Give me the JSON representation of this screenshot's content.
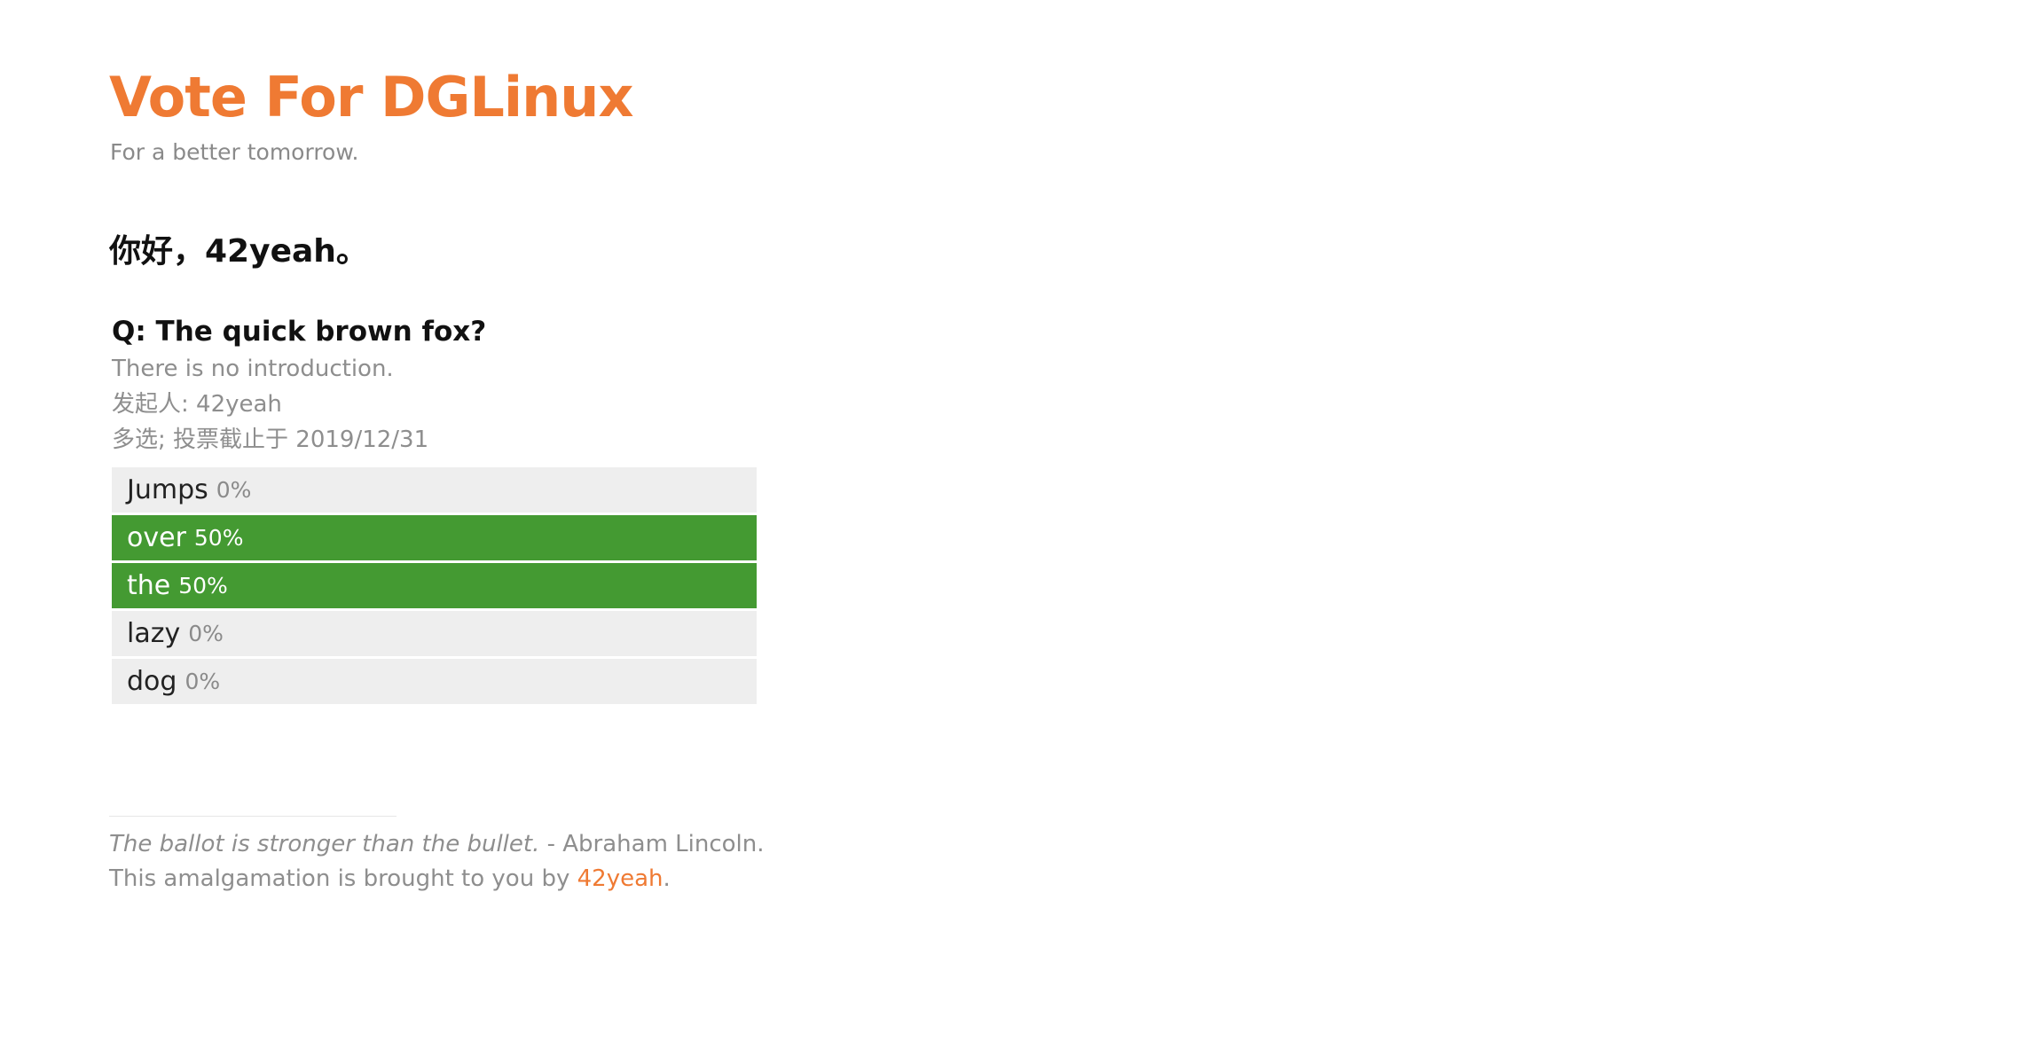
{
  "header": {
    "title": "Vote For DGLinux",
    "subtitle": "For a better tomorrow."
  },
  "greeting": "你好，42yeah。",
  "poll": {
    "question": "Q: The quick brown fox?",
    "introduction": "There is no introduction.",
    "initiator": "发起人: 42yeah",
    "mode_deadline": "多选; 投票截止于 2019/12/31",
    "options": [
      {
        "label": "Jumps",
        "percent": "0%",
        "fraction": 0,
        "selected": false
      },
      {
        "label": "over",
        "percent": "50%",
        "fraction": 1,
        "selected": true
      },
      {
        "label": "the",
        "percent": "50%",
        "fraction": 1,
        "selected": true
      },
      {
        "label": "lazy",
        "percent": "0%",
        "fraction": 0,
        "selected": false
      },
      {
        "label": "dog",
        "percent": "0%",
        "fraction": 0,
        "selected": false
      }
    ]
  },
  "footer": {
    "quote": "The ballot is stronger than the bullet.",
    "attribution": " - Abraham Lincoln.",
    "credit_prefix": "This amalgamation is brought to you by ",
    "credit_link": "42yeah",
    "credit_suffix": "."
  },
  "colors": {
    "accent": "#ef7a33",
    "selected_fill": "#449a32",
    "option_bg": "#eeeeee",
    "muted_text": "#8e8e8e"
  }
}
